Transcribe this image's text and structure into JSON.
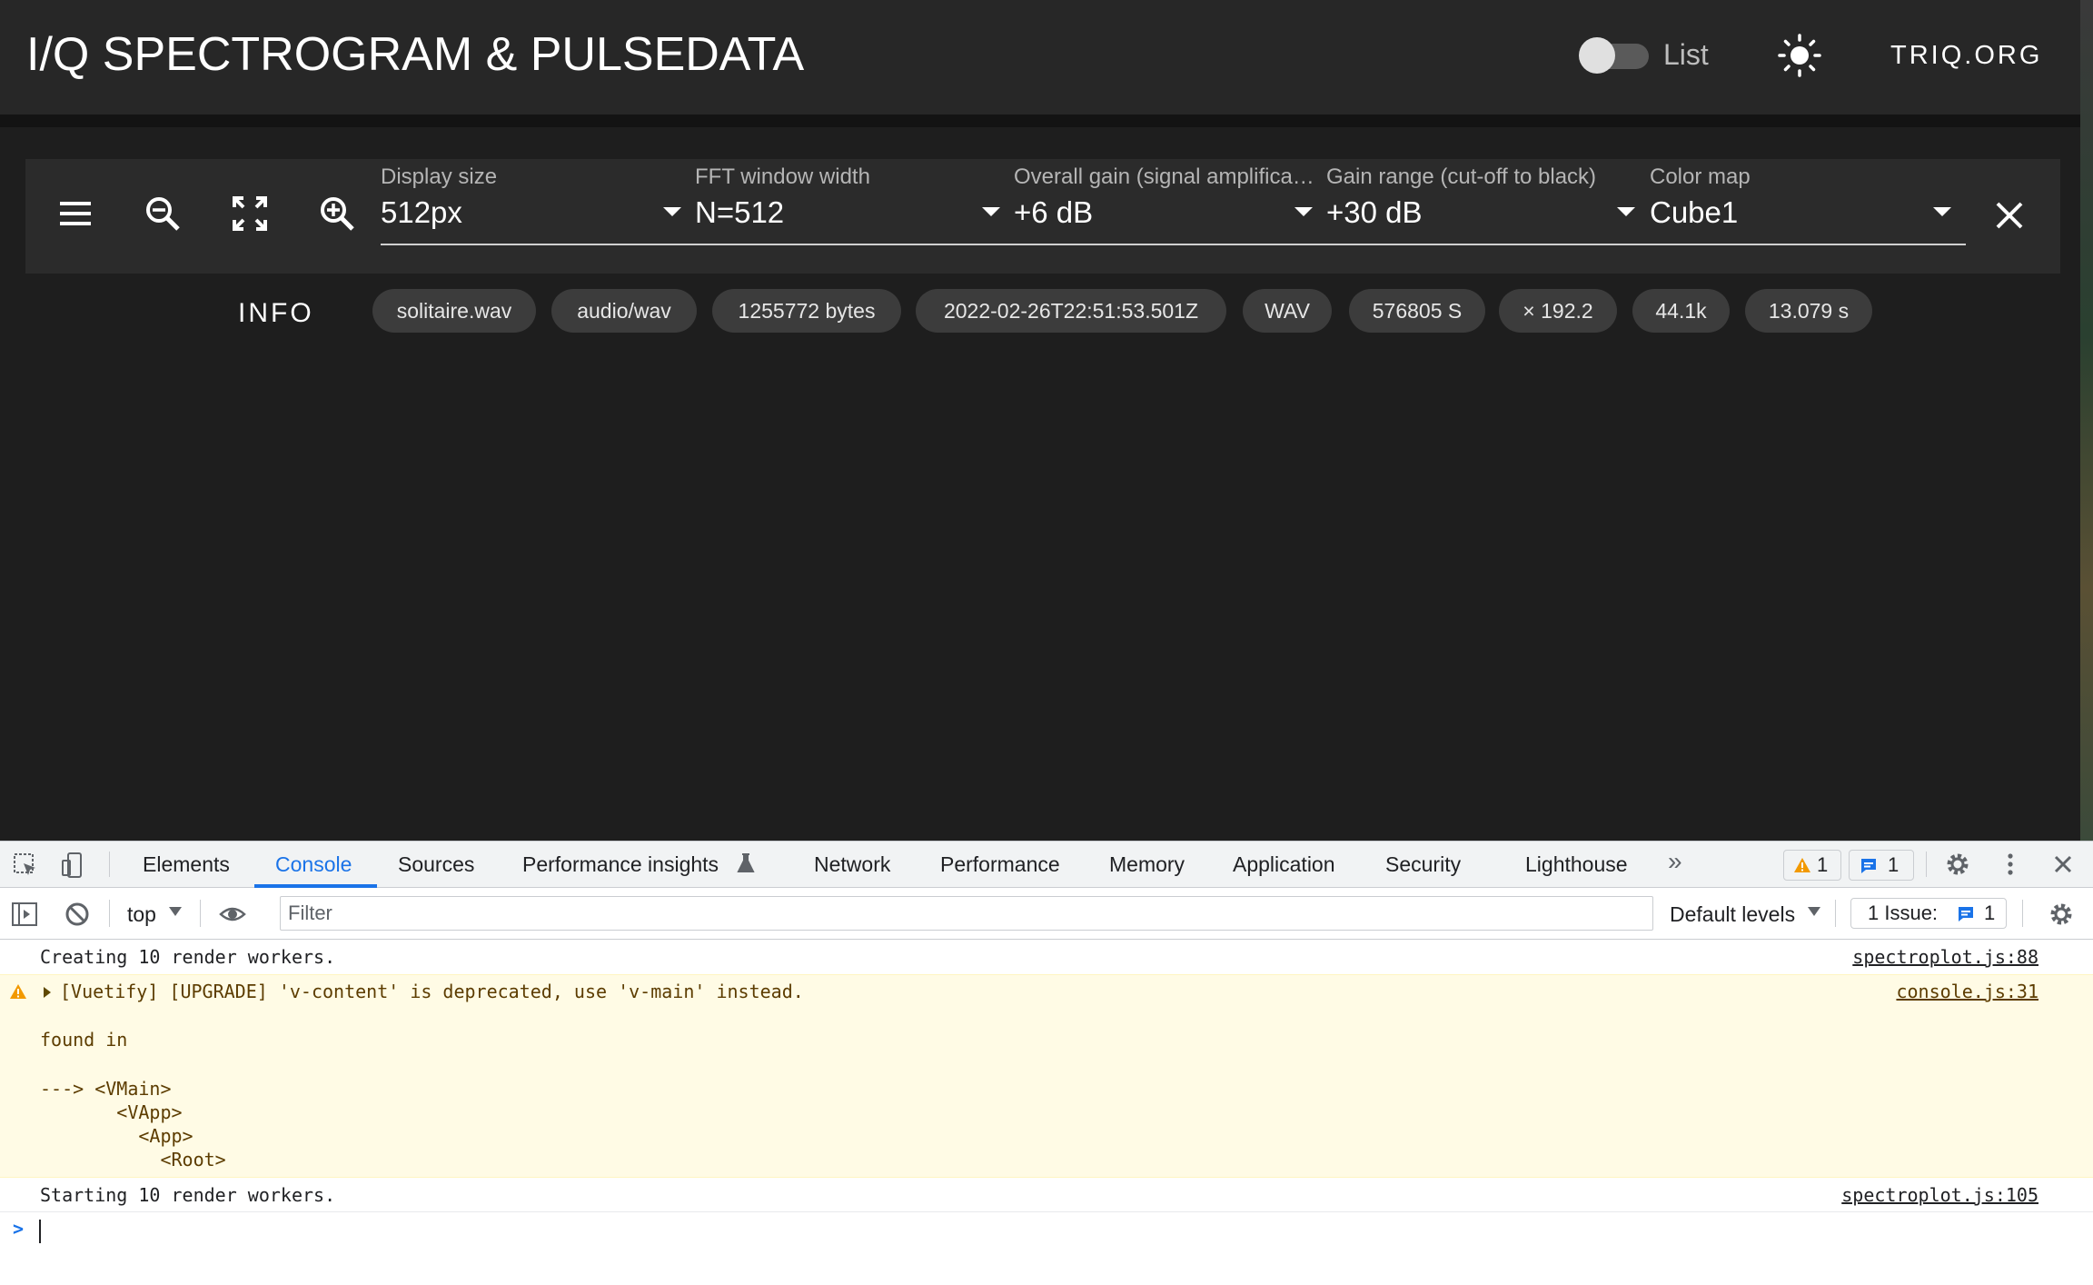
{
  "app": {
    "title": "I/Q SPECTROGRAM & PULSEDATA",
    "toggle_label": "List",
    "theme_icon": "sun-icon",
    "site_link": "TRIQ.ORG"
  },
  "toolbar": {
    "icons": [
      "menu-icon",
      "zoom-out-icon",
      "fullscreen-icon",
      "zoom-in-icon"
    ],
    "fields": [
      {
        "label": "Display size",
        "value": "512px"
      },
      {
        "label": "FFT window width",
        "value": "N=512"
      },
      {
        "label": "Overall gain (signal amplifica…",
        "value": "+6 dB"
      },
      {
        "label": "Gain range (cut-off to black)",
        "value": "+30 dB"
      },
      {
        "label": "Color map",
        "value": "Cube1"
      }
    ],
    "close_icon": "close-icon"
  },
  "info": {
    "label": "INFO",
    "chips": [
      "solitaire.wav",
      "audio/wav",
      "1255772 bytes",
      "2022-02-26T22:51:53.501Z",
      "WAV",
      "576805 S",
      "× 192.2",
      "44.1k",
      "13.079 s"
    ]
  },
  "devtools": {
    "tabs": [
      "Elements",
      "Console",
      "Sources",
      "Performance insights",
      "Network",
      "Performance",
      "Memory",
      "Application",
      "Security",
      "Lighthouse"
    ],
    "active_tab": "Console",
    "more_tabs": "»",
    "warning_count": "1",
    "message_count": "1",
    "context": "top",
    "filter_placeholder": "Filter",
    "levels": "Default levels",
    "issues_label": "1 Issue:",
    "issues_count": "1",
    "console": {
      "line1": {
        "text": "Creating 10 render workers.",
        "source": "spectroplot.js:88"
      },
      "warning": {
        "text": "[Vuetify] [UPGRADE] 'v-content' is deprecated, use 'v-main' instead.",
        "source": "console.js:31",
        "found_in": "found in",
        "trace": [
          "---> <VMain>",
          "       <VApp>",
          "         <App>",
          "           <Root>"
        ]
      },
      "line3": {
        "text": "Starting 10 render workers.",
        "source": "spectroplot.js:105"
      },
      "prompt": ">"
    }
  },
  "colors": {
    "app_bg": "#1e1e1e",
    "appbar": "#272727",
    "chip_bg": "#3c3c3c",
    "devtools_accent": "#1a73e8",
    "warning_bg": "#fffbe5"
  }
}
